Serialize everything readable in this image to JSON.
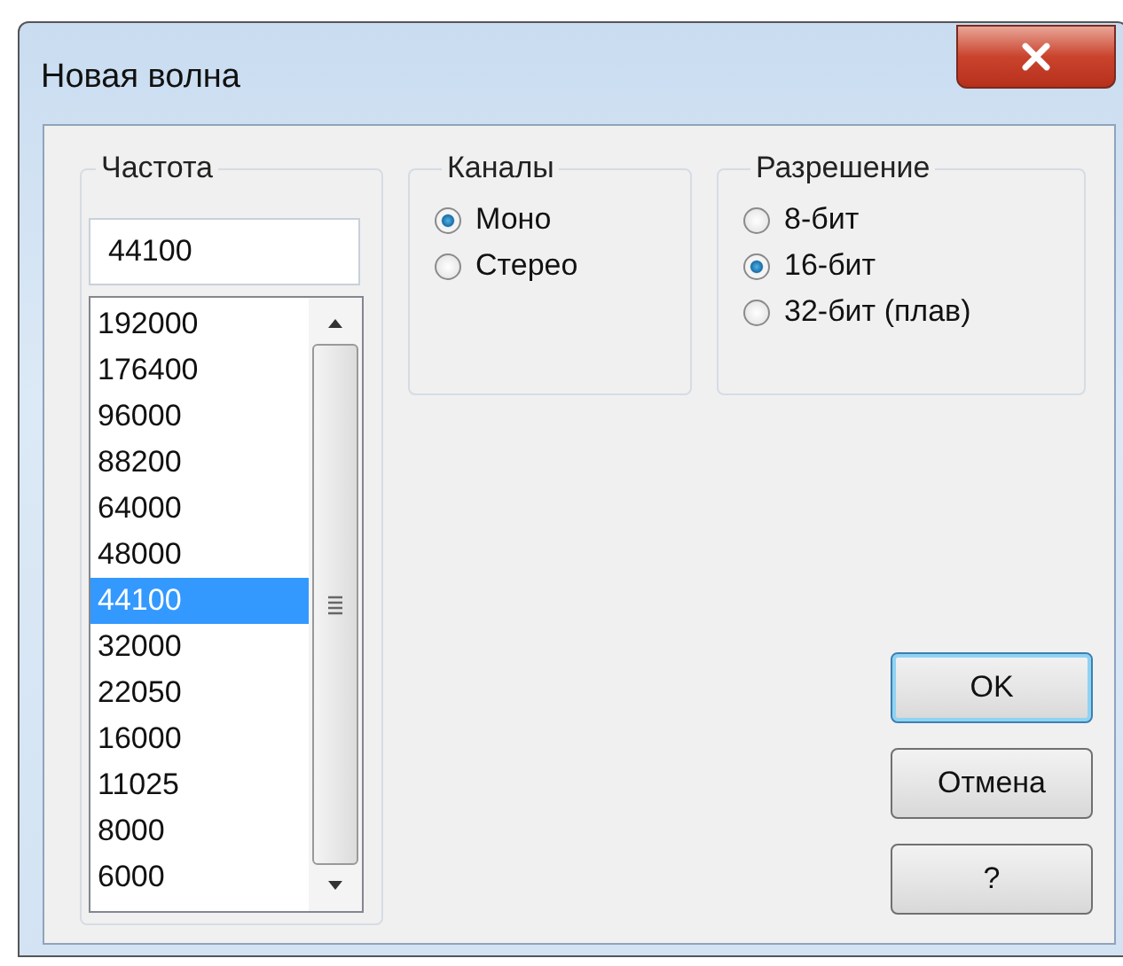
{
  "window": {
    "title": "Новая волна"
  },
  "frequency": {
    "label": "Частота",
    "value": "44100",
    "list": [
      {
        "text": "192000",
        "selected": false
      },
      {
        "text": "176400",
        "selected": false
      },
      {
        "text": "96000",
        "selected": false
      },
      {
        "text": "88200",
        "selected": false
      },
      {
        "text": "64000",
        "selected": false
      },
      {
        "text": "48000",
        "selected": false
      },
      {
        "text": "44100",
        "selected": true
      },
      {
        "text": "32000",
        "selected": false
      },
      {
        "text": "22050",
        "selected": false
      },
      {
        "text": "16000",
        "selected": false
      },
      {
        "text": "11025",
        "selected": false
      },
      {
        "text": "8000",
        "selected": false
      },
      {
        "text": "6000",
        "selected": false
      }
    ]
  },
  "channels": {
    "label": "Каналы",
    "options": [
      {
        "label": "Моно",
        "selected": true
      },
      {
        "label": "Стерео",
        "selected": false
      }
    ]
  },
  "resolution": {
    "label": "Разрешение",
    "options": [
      {
        "label": "8-бит",
        "selected": false
      },
      {
        "label": "16-бит",
        "selected": true
      },
      {
        "label": "32-бит (плав)",
        "selected": false
      }
    ]
  },
  "buttons": [
    {
      "label": "OK",
      "default": true
    },
    {
      "label": "Отмена",
      "default": false
    },
    {
      "label": "?",
      "default": false
    }
  ]
}
